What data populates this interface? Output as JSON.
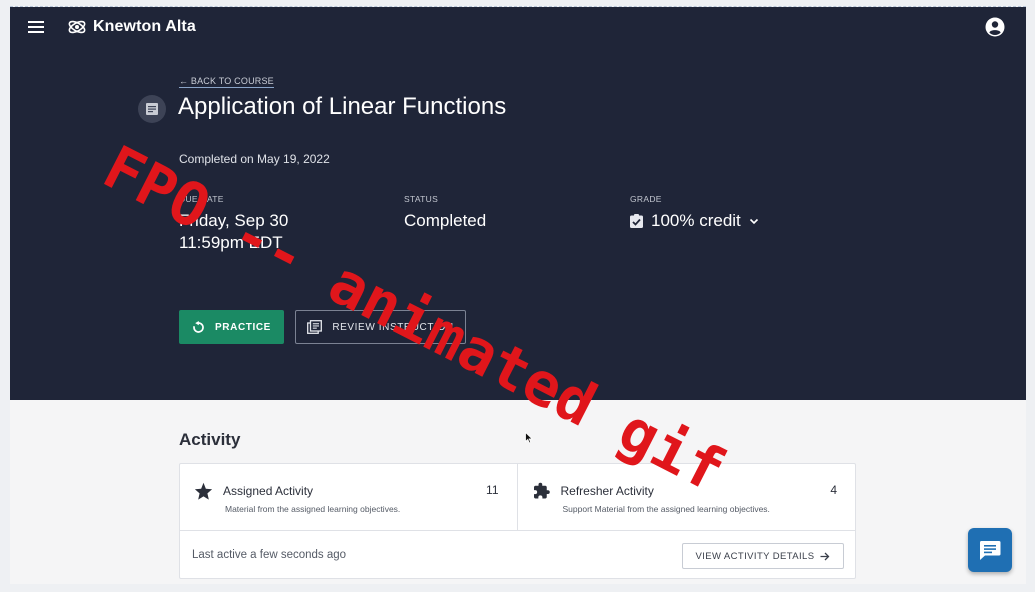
{
  "header": {
    "brand": "Knewton Alta"
  },
  "assignment": {
    "back_link": "← BACK TO COURSE",
    "title": "Application of Linear Functions",
    "completed_on": "Completed on May 19, 2022",
    "due_label": "DUE DATE",
    "due_line1": "Friday, Sep 30",
    "due_line2": "11:59pm EDT",
    "status_label": "STATUS",
    "status_value": "Completed",
    "grade_label": "GRADE",
    "grade_value": "100% credit"
  },
  "actions": {
    "practice_label": "PRACTICE",
    "review_label": "REVIEW INSTRUCTION"
  },
  "activity": {
    "heading": "Activity",
    "assigned": {
      "title": "Assigned Activity",
      "count": "11",
      "description": "Material from the assigned learning objectives."
    },
    "refresher": {
      "title": "Refresher Activity",
      "count": "4",
      "description": "Support Material from the assigned learning objectives."
    },
    "last_active": "Last active a few seconds ago",
    "details_label": "VIEW ACTIVITY DETAILS"
  },
  "overlay": {
    "watermark": "FPO -- animated gif"
  },
  "colors": {
    "hero_bg": "#1f2538",
    "practice_green": "#1b8a64",
    "chat_blue": "#1f6fb3",
    "watermark_red": "#e0161b"
  },
  "icons": [
    "menu-icon",
    "logo-icon",
    "account-icon",
    "document-icon",
    "check-clipboard-icon",
    "chevron-down-icon",
    "refresh-icon",
    "library-books-icon",
    "star-icon",
    "puzzle-icon",
    "arrow-right-icon",
    "chat-icon",
    "cursor-icon"
  ]
}
